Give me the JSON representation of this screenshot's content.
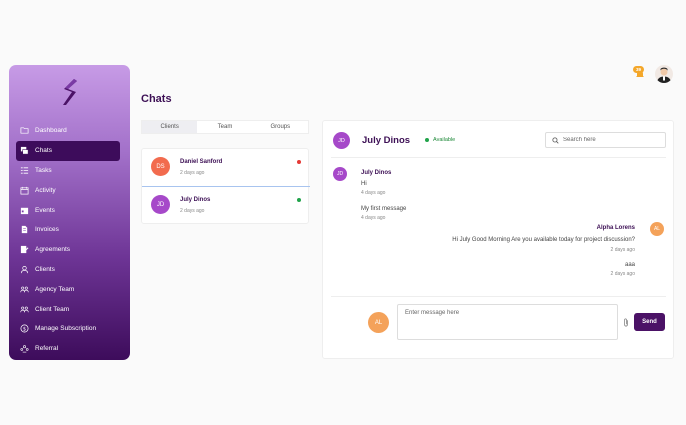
{
  "sidebar": {
    "items": [
      {
        "label": "Dashboard",
        "icon": "folder-icon"
      },
      {
        "label": "Chats",
        "icon": "chat-icon",
        "active": true
      },
      {
        "label": "Tasks",
        "icon": "tasks-icon"
      },
      {
        "label": "Activity",
        "icon": "activity-icon"
      },
      {
        "label": "Events",
        "icon": "calendar-icon"
      },
      {
        "label": "Invoices",
        "icon": "invoice-icon"
      },
      {
        "label": "Agreements",
        "icon": "agreement-icon"
      },
      {
        "label": "Clients",
        "icon": "user-icon"
      },
      {
        "label": "Agency Team",
        "icon": "team-icon"
      },
      {
        "label": "Client Team",
        "icon": "team-icon"
      },
      {
        "label": "Manage Subscription",
        "icon": "dollar-icon"
      },
      {
        "label": "Referral",
        "icon": "referral-icon"
      }
    ]
  },
  "header": {
    "notification_count": "39"
  },
  "page": {
    "title": "Chats"
  },
  "tabs": [
    "Clients",
    "Team",
    "Groups"
  ],
  "conversations": [
    {
      "initials": "DS",
      "name": "Daniel Sanford",
      "time": "2 days ago",
      "avatar_color": "#f26b4e",
      "status_color": "#e53935"
    },
    {
      "initials": "JD",
      "name": "July Dinos",
      "time": "2 days ago",
      "avatar_color": "#a649c9",
      "status_color": "#21a34b"
    }
  ],
  "chat": {
    "initials": "JD",
    "name": "July Dinos",
    "status": "Available",
    "search_placeholder": "Search here",
    "messages": {
      "incoming_sender": "July Dinos",
      "incoming_initials": "JD",
      "m1_text": "Hi",
      "m1_time": "4 days ago",
      "m2_text": "My first message",
      "m2_time": "4 days ago",
      "outgoing_sender": "Alpha Lorens",
      "outgoing_initials": "AL",
      "m3_text": "Hi July Good Morning Are you available today for project discussion?",
      "m3_time": "2 days ago",
      "m4_text": "aaa",
      "m4_time": "2 days ago"
    },
    "composer": {
      "initials": "AL",
      "placeholder": "Enter message here",
      "send_label": "Send"
    }
  },
  "colors": {
    "brand": "#4b1266",
    "available": "#21a34b",
    "badge": "#f4a72a"
  }
}
